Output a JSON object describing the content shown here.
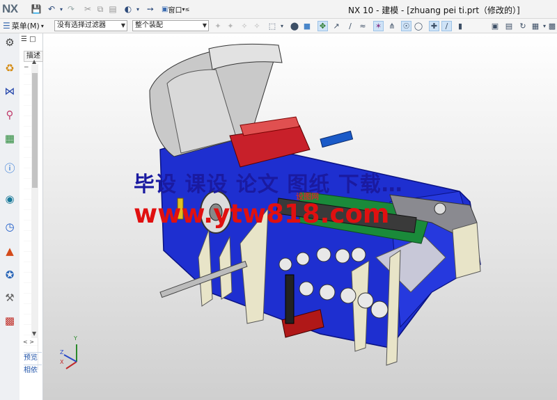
{
  "app": {
    "logo": "NX",
    "title": "NX 10 - 建模 - [zhuang pei ti.prt（修改的）]"
  },
  "toolbar": {
    "menu_label": "菜单(M)",
    "filter_combo": "没有选择过滤器",
    "assembly_combo": "整个装配",
    "window_label": "窗口"
  },
  "navigator": {
    "column_header": "描述",
    "expand_glyph": "−",
    "hscroll": "< >",
    "sections": [
      "预览",
      "相依"
    ]
  },
  "viewport": {
    "watermark_line1": "毕设 课设 论文 图纸 下载…",
    "watermark_line2": "www.ytw818.com",
    "watermark_small": "设图网",
    "triad_labels": {
      "x": "X",
      "y": "Y",
      "z": "Z"
    }
  },
  "icons": {
    "quick_access": [
      "save-icon",
      "undo-icon",
      "redo-icon",
      "cut-icon",
      "copy-icon",
      "paste-icon",
      "render-style-icon",
      "switch-window-icon"
    ],
    "resource_bar": [
      "gear-icon",
      "assembly-navigator-icon",
      "constraint-navigator-icon",
      "part-navigator-icon",
      "reuse-library-icon",
      "web-browser-icon",
      "history-icon",
      "process-icon",
      "palette-icon",
      "roles-icon",
      "system-icon",
      "print-icon"
    ]
  },
  "colors": {
    "accent": "#2255aa",
    "watermark_blue": "#1a1aa0",
    "watermark_red": "#e01010",
    "model_blue": "#1e2fd0"
  }
}
